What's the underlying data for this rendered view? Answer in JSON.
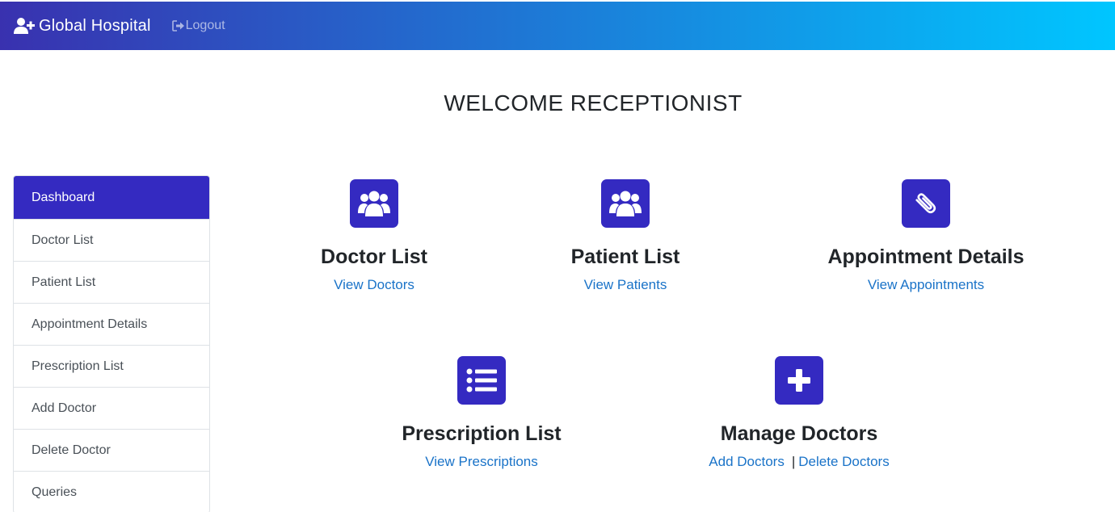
{
  "navbar": {
    "brand": "Global Hospital",
    "logout": "Logout"
  },
  "welcome": "WELCOME RECEPTIONIST",
  "sidebar": {
    "items": [
      {
        "label": "Dashboard",
        "active": true
      },
      {
        "label": "Doctor List"
      },
      {
        "label": "Patient List"
      },
      {
        "label": "Appointment Details"
      },
      {
        "label": "Prescription List"
      },
      {
        "label": "Add Doctor"
      },
      {
        "label": "Delete Doctor"
      },
      {
        "label": "Queries"
      }
    ]
  },
  "cards": {
    "doctor_list": {
      "title": "Doctor List",
      "link": "View Doctors",
      "icon": "users-icon"
    },
    "patient_list": {
      "title": "Patient List",
      "link": "View Patients",
      "icon": "users-icon"
    },
    "appointment_details": {
      "title": "Appointment Details",
      "link": "View Appointments",
      "icon": "paperclip-icon"
    },
    "prescription_list": {
      "title": "Prescription List",
      "link": "View Prescriptions",
      "icon": "list-icon"
    },
    "manage_doctors": {
      "title": "Manage Doctors",
      "link_add": "Add Doctors",
      "separator": "|",
      "link_delete": "Delete Doctors",
      "icon": "plus-icon"
    }
  },
  "colors": {
    "accent": "#342ac1",
    "nav_gradient_start": "#3931af",
    "nav_gradient_end": "#00c6ff",
    "link": "#1a73c8"
  }
}
